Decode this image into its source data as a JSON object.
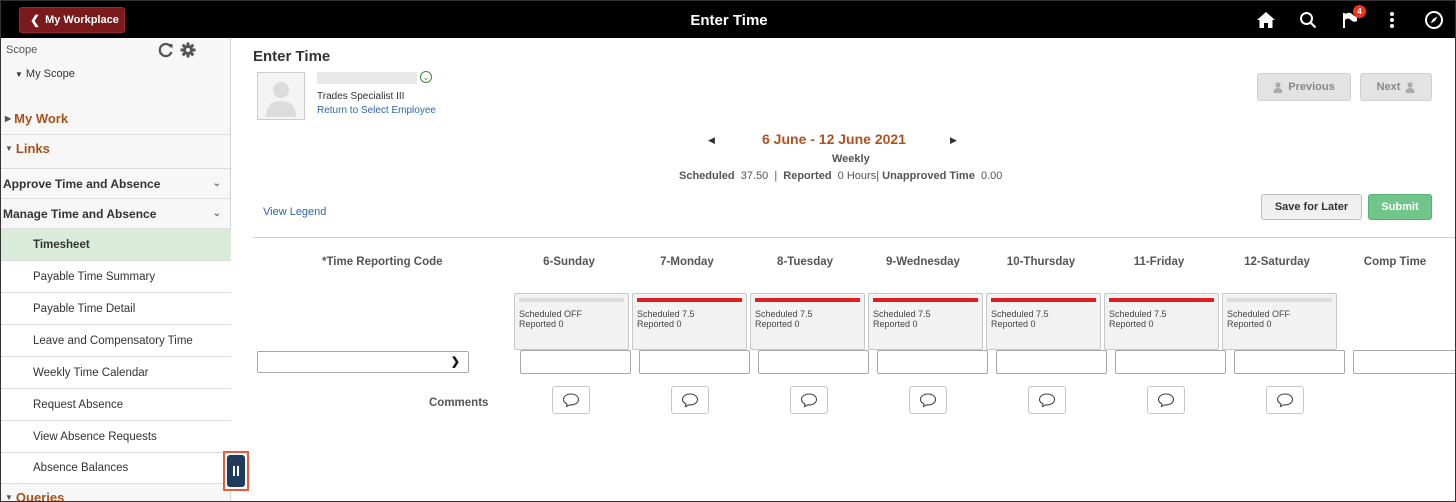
{
  "header": {
    "back_label": "My Workplace",
    "title": "Enter Time",
    "notification_count": "4",
    "icons": [
      "home-icon",
      "search-icon",
      "notification-flag-icon",
      "actions-menu-icon",
      "navbar-compass-icon"
    ]
  },
  "sidebar": {
    "scope_label": "Scope",
    "my_scope": "My Scope",
    "sections": {
      "my_work": "My Work",
      "links": "Links",
      "queries": "Queries"
    },
    "groups": {
      "approve": "Approve Time and Absence",
      "manage": "Manage Time and Absence"
    },
    "items": [
      {
        "label": "Timesheet",
        "active": true
      },
      {
        "label": "Payable Time Summary"
      },
      {
        "label": "Payable Time Detail"
      },
      {
        "label": "Leave and Compensatory Time"
      },
      {
        "label": "Weekly Time Calendar"
      },
      {
        "label": "Request Absence"
      },
      {
        "label": "View Absence Requests"
      },
      {
        "label": "Absence Balances"
      }
    ]
  },
  "main": {
    "page_title": "Enter Time",
    "employee": {
      "job_title": "Trades Specialist III",
      "return_link": "Return to Select Employee"
    },
    "nav": {
      "previous": "Previous",
      "next": "Next"
    },
    "period": {
      "range": "6 June - 12 June 2021",
      "frequency": "Weekly"
    },
    "summary": {
      "scheduled_label": "Scheduled",
      "scheduled_value": "37.50",
      "reported_label": "Reported",
      "reported_value": "0 Hours",
      "unapproved_label": "Unapproved Time",
      "unapproved_value": "0.00"
    },
    "view_legend": "View Legend",
    "buttons": {
      "save_for_later": "Save for Later",
      "submit": "Submit"
    },
    "grid": {
      "trc_header": "*Time Reporting Code",
      "comments_label": "Comments",
      "columns": [
        "6-Sunday",
        "7-Monday",
        "8-Tuesday",
        "9-Wednesday",
        "10-Thursday",
        "11-Friday",
        "12-Saturday",
        "Comp Time"
      ],
      "days": [
        {
          "scheduled": "Scheduled OFF",
          "reported": "Reported  0",
          "status_color": "#dcdcdc"
        },
        {
          "scheduled": "Scheduled 7.5",
          "reported": "Reported  0",
          "status_color": "#e01e1e"
        },
        {
          "scheduled": "Scheduled 7.5",
          "reported": "Reported  0",
          "status_color": "#e01e1e"
        },
        {
          "scheduled": "Scheduled 7.5",
          "reported": "Reported  0",
          "status_color": "#e01e1e"
        },
        {
          "scheduled": "Scheduled 7.5",
          "reported": "Reported  0",
          "status_color": "#e01e1e"
        },
        {
          "scheduled": "Scheduled 7.5",
          "reported": "Reported  0",
          "status_color": "#e01e1e"
        },
        {
          "scheduled": "Scheduled OFF",
          "reported": "Reported  0",
          "status_color": "#dcdcdc"
        }
      ]
    }
  }
}
